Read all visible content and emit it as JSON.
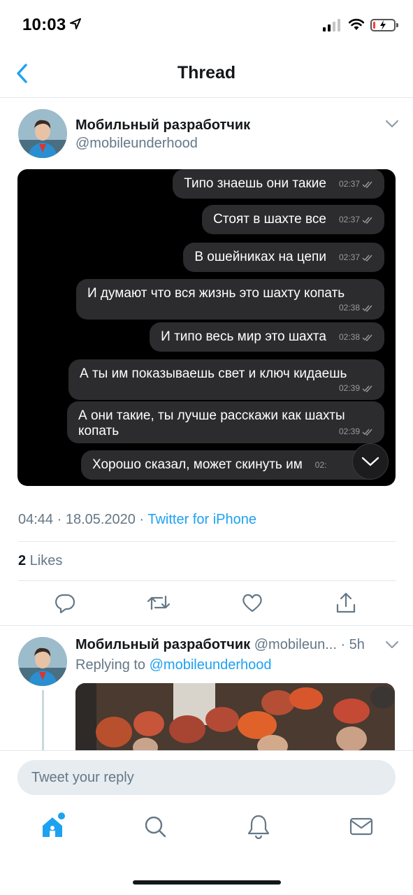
{
  "status_bar": {
    "time": "10:03",
    "signal_bars_filled": 2,
    "signal_bars_total": 4,
    "battery_level": 0.1
  },
  "nav": {
    "title": "Thread",
    "back_icon": "chevron-left-icon"
  },
  "tweet": {
    "author_name": "Мобильный разработчик",
    "author_handle": "@mobileunderhood",
    "chat_messages": [
      {
        "text": "Типо знаешь они такие",
        "time": "02:37"
      },
      {
        "text": "Стоят в шахте все",
        "time": "02:37"
      },
      {
        "text": "В ошейниках на цепи",
        "time": "02:37"
      },
      {
        "text": "И думают что вся жизнь это шахту копать",
        "time": "02:38"
      },
      {
        "text": "И типо весь мир это шахта",
        "time": "02:38"
      },
      {
        "text": "А ты им показываешь свет и ключ кидаешь",
        "time": "02:39"
      },
      {
        "text": "А они такие, ты лучше расскажи как шахты копать",
        "time": "02:39"
      },
      {
        "text": "Хорошо сказал, может скинуть им",
        "time": "02:"
      }
    ],
    "timestamp": "04:44 · 18.05.2020 · ",
    "source": "Twitter for iPhone",
    "likes_count": "2",
    "likes_label": " Likes",
    "actions": [
      "reply-icon",
      "retweet-icon",
      "like-icon",
      "share-icon"
    ]
  },
  "reply_tweet": {
    "author_name": "Мобильный разработчик",
    "author_handle": "@mobileun...",
    "age": " · 5h",
    "replying_prefix": "Replying to ",
    "replying_to": "@mobileunderhood"
  },
  "composer": {
    "placeholder": "Tweet your reply"
  },
  "tab_bar": {
    "tabs": [
      "home-icon",
      "search-icon",
      "notifications-icon",
      "messages-icon"
    ],
    "accent": "#1da1f2"
  },
  "colors": {
    "accent": "#1da1f2",
    "text_primary": "#14171a",
    "text_secondary": "#657786",
    "chat_background": "#000000",
    "bubble": "#2c2c2e"
  }
}
